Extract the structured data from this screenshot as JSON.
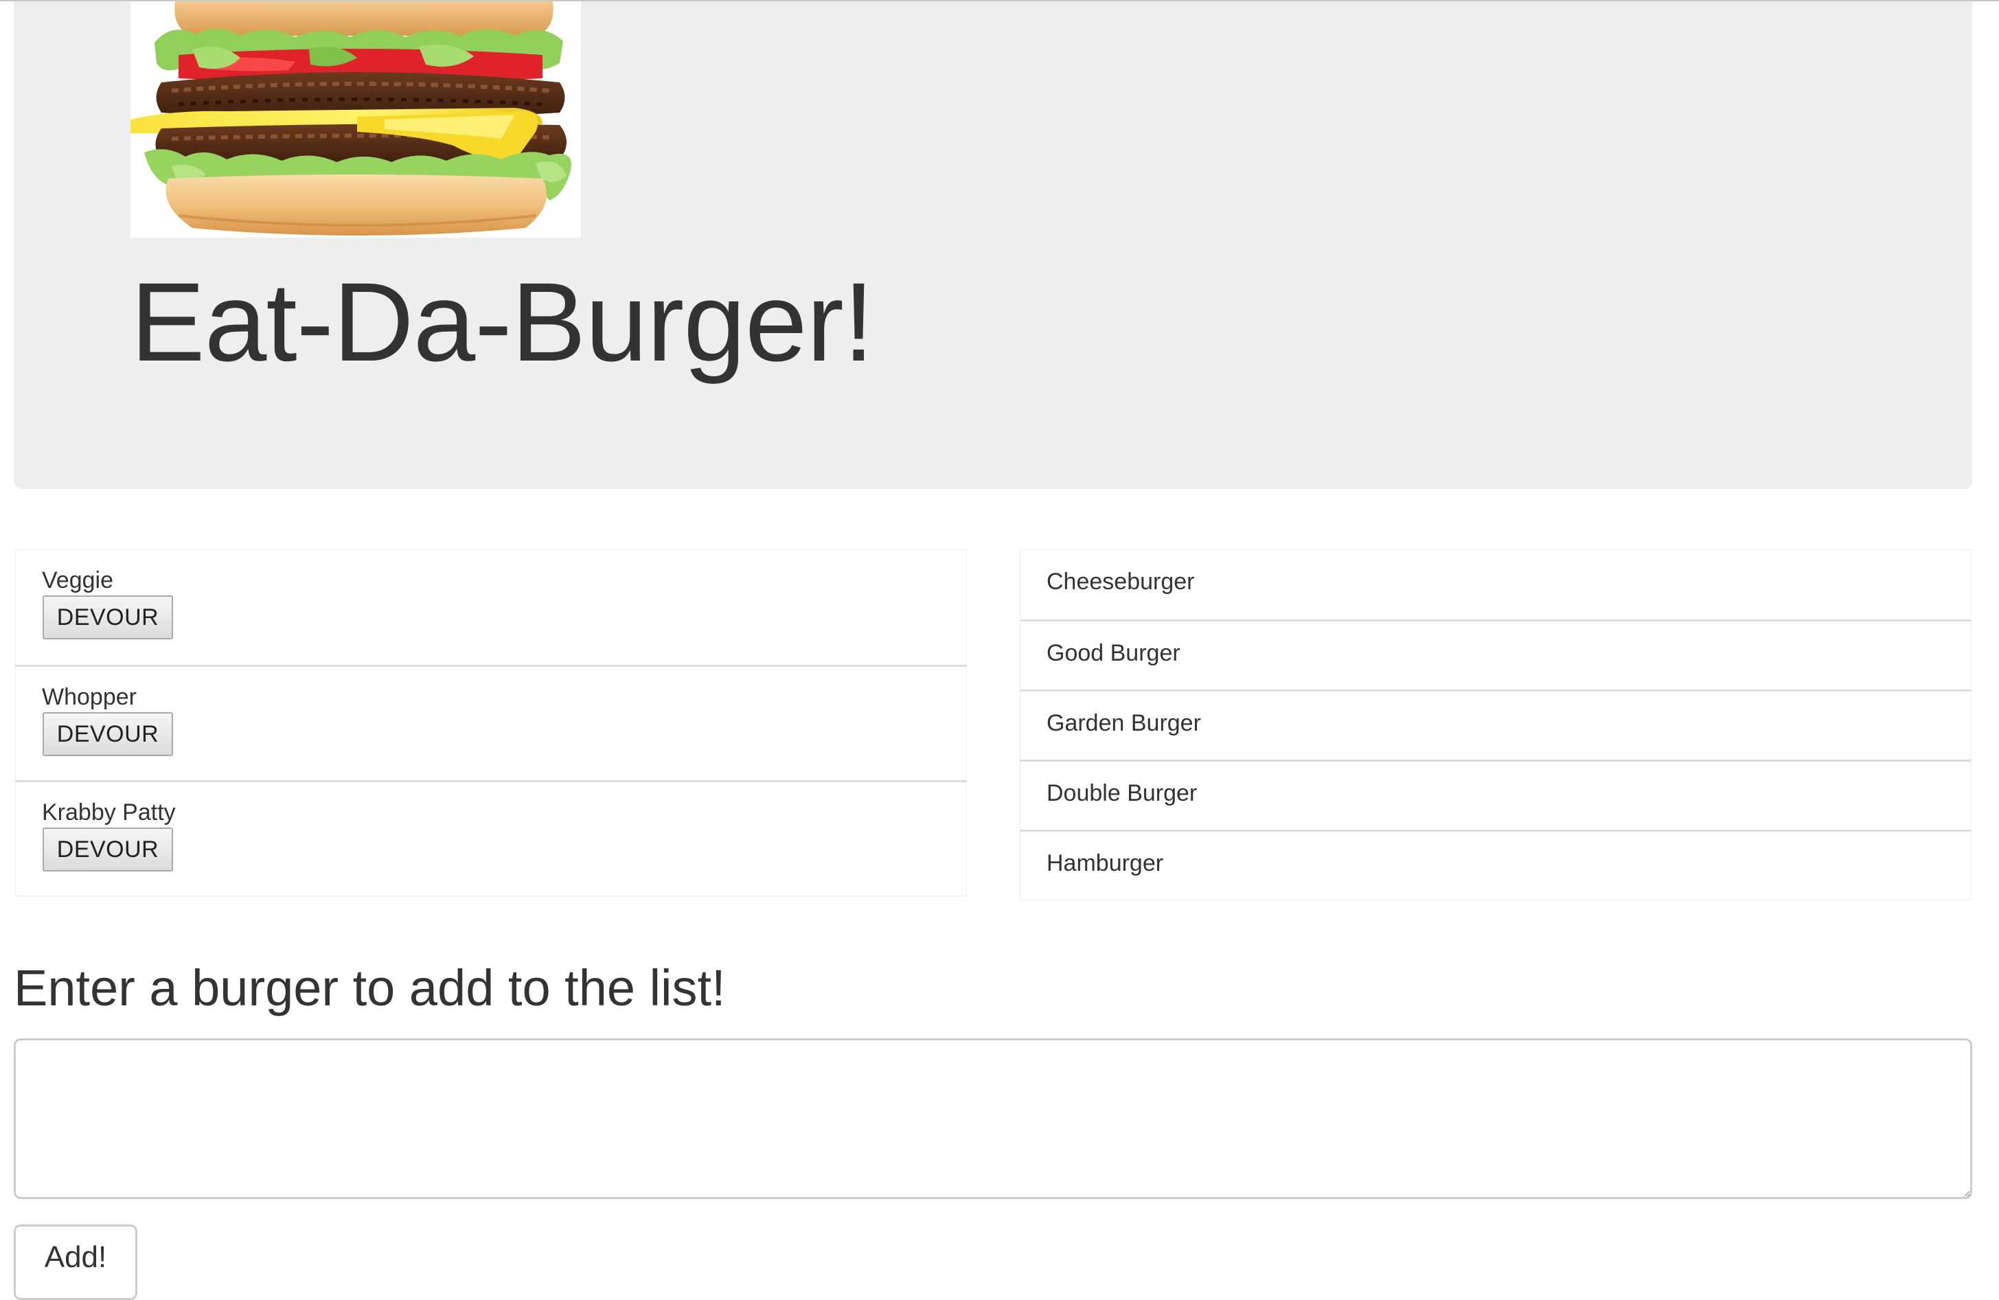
{
  "header": {
    "logo_icon": "burger-image",
    "title": "Eat-Da-Burger!"
  },
  "uneaten": {
    "button_label": "DEVOUR",
    "items": [
      {
        "name": "Veggie"
      },
      {
        "name": "Whopper"
      },
      {
        "name": "Krabby Patty"
      }
    ]
  },
  "devoured": {
    "items": [
      {
        "name": "Cheeseburger"
      },
      {
        "name": "Good Burger"
      },
      {
        "name": "Garden Burger"
      },
      {
        "name": "Double Burger"
      },
      {
        "name": "Hamburger"
      }
    ]
  },
  "form": {
    "heading": "Enter a burger to add to the list!",
    "input_value": "",
    "submit_label": "Add!"
  },
  "colors": {
    "jumbotron_bg": "#eeeeee",
    "text": "#333333",
    "divider": "#dddddd",
    "input_border": "#cccccc"
  }
}
